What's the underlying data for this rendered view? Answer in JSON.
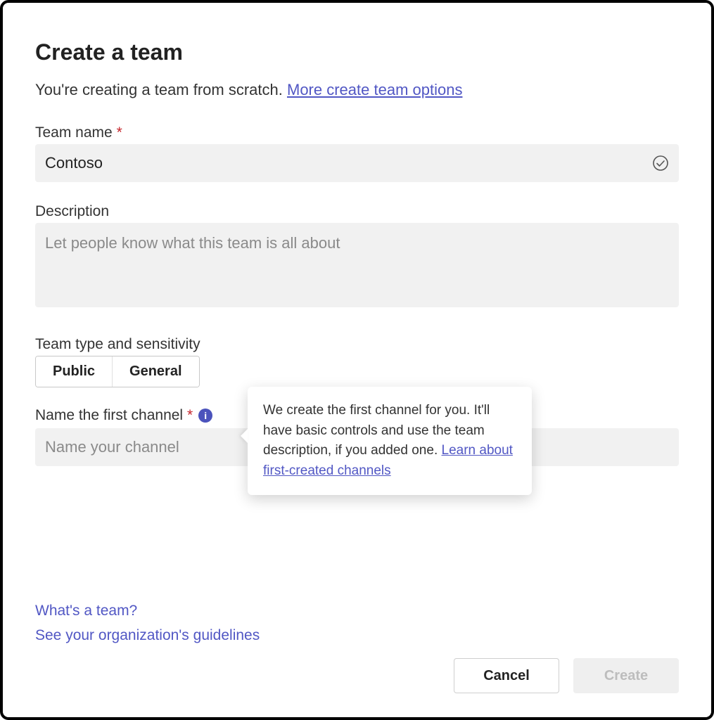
{
  "header": {
    "title": "Create a team",
    "subtitle_text": "You're creating a team from scratch. ",
    "more_options_link": "More create team options"
  },
  "team_name": {
    "label": "Team name",
    "required_marker": "*",
    "value": "Contoso"
  },
  "description": {
    "label": "Description",
    "placeholder": "Let people know what this team is all about"
  },
  "type_sensitivity": {
    "label": "Team type and sensitivity",
    "option_public": "Public",
    "option_general": "General"
  },
  "first_channel": {
    "label": "Name the first channel",
    "required_marker": "*",
    "info_glyph": "i",
    "placeholder": "Name your channel"
  },
  "tooltip": {
    "body": "We create the first channel for you. It'll have basic controls and use the team description, if you added one. ",
    "link": "Learn about first-created channels"
  },
  "footer_links": {
    "whats_team": "What's a team?",
    "guidelines": "See your organization's guidelines"
  },
  "buttons": {
    "cancel": "Cancel",
    "create": "Create"
  }
}
